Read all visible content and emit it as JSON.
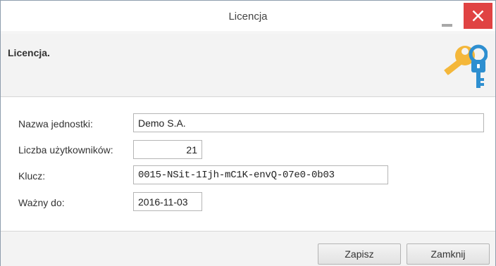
{
  "window": {
    "title": "Licencja",
    "minimize_icon": "minimize-icon",
    "close_icon": "close-icon",
    "close_color": "#e04343"
  },
  "header": {
    "title": "Licencja.",
    "icon": "keys-icon",
    "key_colors": [
      "#f4b73a",
      "#2e8fd0"
    ]
  },
  "form": {
    "unit_name": {
      "label": "Nazwa jednostki:",
      "value": "Demo S.A."
    },
    "user_count": {
      "label": "Liczba użytkowników:",
      "value": "21"
    },
    "key": {
      "label": "Klucz:",
      "value": "0015-NSit-1Ijh-mC1K-envQ-07e0-0b03"
    },
    "valid_until": {
      "label": "Ważny do:",
      "value": "2016-11-03"
    }
  },
  "footer": {
    "save_label": "Zapisz",
    "close_label": "Zamknij"
  }
}
